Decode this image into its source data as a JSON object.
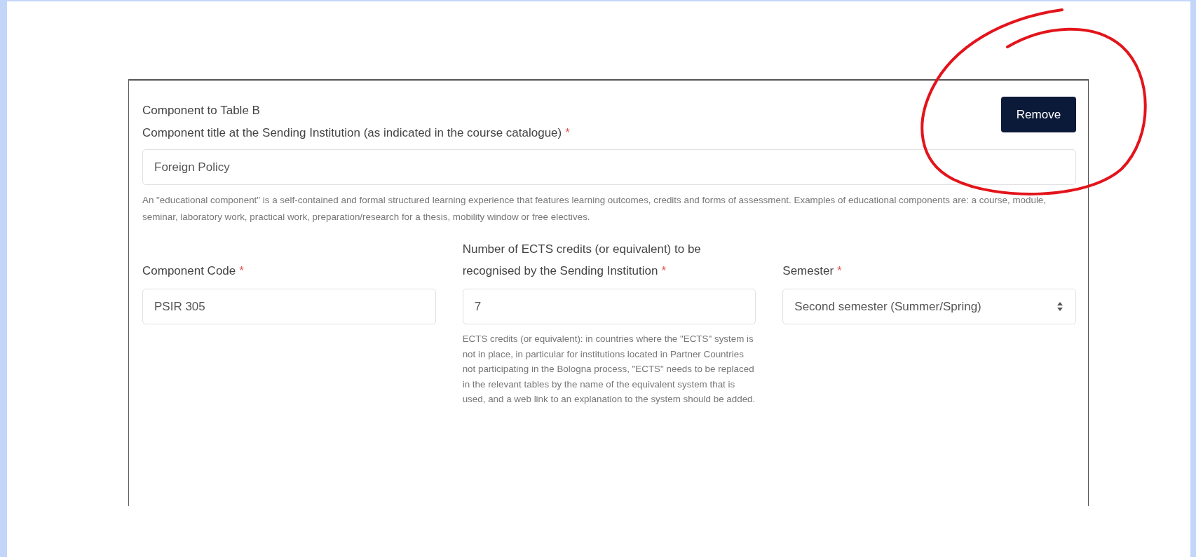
{
  "section": {
    "title": "Component to Table B",
    "remove_button": "Remove"
  },
  "title_field": {
    "kind": "text",
    "label": "Component title at the Sending Institution (as indicated in the course catalogue)",
    "required_mark": "*",
    "value": "Foreign Policy",
    "help": "An \"educational component\" is a self-contained and formal structured learning experience that features learning outcomes, credits and forms of assessment. Examples of educational components are: a course, module, seminar, laboratory work, practical work, preparation/research for a thesis, mobility window or free electives."
  },
  "row_fields": [
    {
      "kind": "text",
      "label": "Component Code",
      "required_mark": "*",
      "value": "PSIR 305"
    },
    {
      "kind": "text",
      "label": "Number of ECTS credits (or equivalent) to be recognised by the Sending Institution",
      "required_mark": "*",
      "value": "7",
      "help": "ECTS credits (or equivalent): in countries where the \"ECTS\" system is not in place, in particular for institutions located in Partner Countries not participating in the Bologna process, \"ECTS\" needs to be replaced in the relevant tables by the name of the equivalent system that is used, and a web link to an explanation to the system should be added."
    },
    {
      "kind": "select",
      "label": "Semester",
      "required_mark": "*",
      "value": "Second semester (Summer/Spring)"
    }
  ]
}
